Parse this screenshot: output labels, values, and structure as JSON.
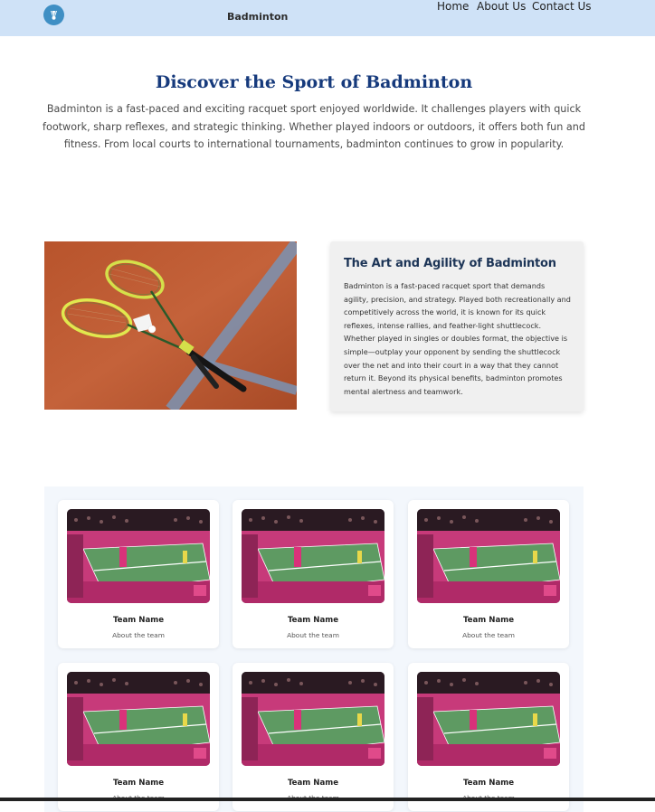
{
  "navbar": {
    "brand": "Badminton",
    "links": [
      "Home",
      "About Us",
      "Contact Us"
    ]
  },
  "hero": {
    "title": "Discover the Sport of Badminton",
    "text": "Badminton is a fast-paced and exciting racquet sport enjoyed worldwide. It challenges players with quick footwork, sharp reflexes, and strategic thinking. Whether played indoors or outdoors, it offers both fun and fitness. From local courts to international tournaments, badminton continues to grow in popularity."
  },
  "feature": {
    "title": "The Art and Agility of Badminton",
    "text": "Badminton is a fast-paced racquet sport that demands agility, precision, and strategy. Played both recreationally and competitively across the world, it is known for its quick reflexes, intense rallies, and feather-light shuttlecock. Whether played in singles or doubles format, the objective is simple—outplay your opponent by sending the shuttlecock over the net and into their court in a way that they cannot return it. Beyond its physical benefits, badminton promotes mental alertness and teamwork."
  },
  "teams": [
    {
      "name": "Team Name",
      "about": "About the team"
    },
    {
      "name": "Team Name",
      "about": "About the team"
    },
    {
      "name": "Team Name",
      "about": "About the team"
    },
    {
      "name": "Team Name",
      "about": "About the team"
    },
    {
      "name": "Team Name",
      "about": "About the team"
    },
    {
      "name": "Team Name",
      "about": "About the team"
    }
  ],
  "colors": {
    "navbar_bg": "#cfe2f7",
    "title": "#163a7c",
    "feature_title": "#1d3557"
  },
  "icons": {
    "logo": "shuttlecock-icon"
  }
}
